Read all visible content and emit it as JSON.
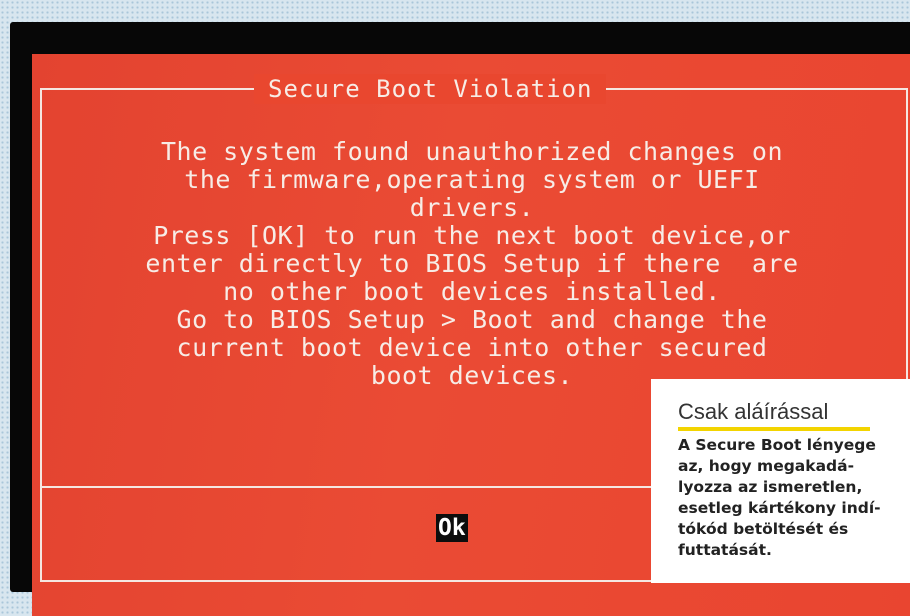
{
  "dialog": {
    "title": "Secure Boot Violation",
    "message_lines": [
      "The system found unauthorized changes on",
      "the firmware,operating system or UEFI",
      "drivers.",
      "Press [OK] to run the next boot device,or",
      "enter directly to BIOS Setup if there  are",
      "no other boot devices installed.",
      "Go to BIOS Setup > Boot and change the",
      "current boot device into other secured",
      "boot devices."
    ],
    "ok_label": "Ok"
  },
  "sidebar": {
    "title": "Csak aláírással",
    "text_lines": [
      "A Secure Boot lényege",
      "az, hogy megakadá-",
      "lyozza az ismeretlen,",
      "esetleg kártékony indí-",
      "tókód betöltését és",
      "futtatását."
    ]
  },
  "colors": {
    "dialog_background": "#e8432f",
    "dialog_text": "#f7ece6",
    "highlight": "#f3d400",
    "selected_button": "#0d0d0d"
  }
}
